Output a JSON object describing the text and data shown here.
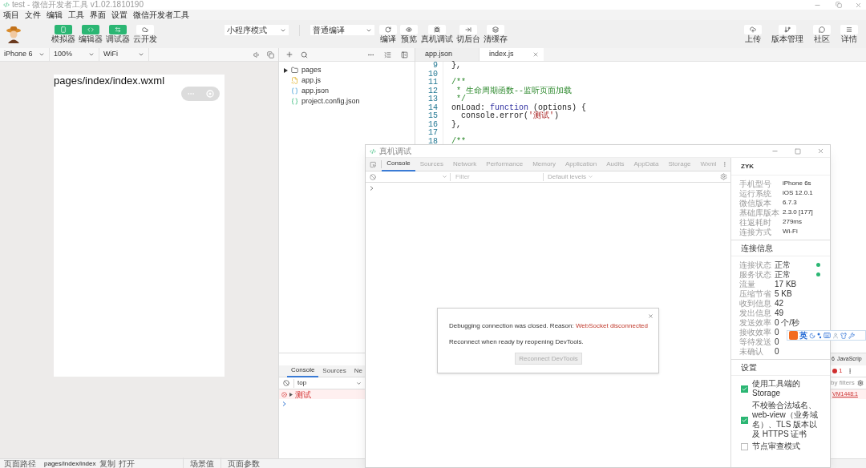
{
  "window": {
    "title": "test - 微信开发者工具 v1.02.1810190"
  },
  "menu": [
    "项目",
    "文件",
    "编辑",
    "工具",
    "界面",
    "设置",
    "微信开发者工具"
  ],
  "toolbar": {
    "toggles": [
      {
        "label": "模拟器",
        "on": true
      },
      {
        "label": "编辑器",
        "on": true
      },
      {
        "label": "调试器",
        "on": true
      },
      {
        "label": "云开发",
        "on": false
      }
    ],
    "mode_select": "小程序模式",
    "compile_select": "普通编译",
    "actions": [
      "编译",
      "预览",
      "真机调试",
      "切后台",
      "清缓存"
    ],
    "right_actions": [
      "上传",
      "版本管理",
      "社区",
      "详情"
    ]
  },
  "simulator": {
    "device": "iPhone 6",
    "zoom": "100%",
    "network": "WiFi",
    "page_text": "pages/index/index.wxml"
  },
  "file_tree": [
    {
      "name": "pages",
      "kind": "folder",
      "expanded": false
    },
    {
      "name": "app.js",
      "kind": "js"
    },
    {
      "name": "app.json",
      "kind": "json"
    },
    {
      "name": "project.config.json",
      "kind": "config"
    }
  ],
  "editor": {
    "tabs": [
      {
        "label": "app.json",
        "selected": false
      },
      {
        "label": "index.js",
        "selected": true
      }
    ],
    "lines": [
      {
        "number": "9",
        "tokens": [
          {
            "text": "},",
            "kind": "plain"
          }
        ]
      },
      {
        "number": "10"
      },
      {
        "number": "11",
        "tokens": [
          {
            "text": "/**",
            "kind": "comment"
          }
        ]
      },
      {
        "number": "12",
        "tokens": [
          {
            "text": " * 生命周期函数--监听页面加载",
            "kind": "comment"
          }
        ]
      },
      {
        "number": "13",
        "tokens": [
          {
            "text": " */",
            "kind": "comment"
          }
        ]
      },
      {
        "number": "14",
        "tokens": [
          {
            "text": "onLoad: ",
            "kind": "plain"
          },
          {
            "text": "function",
            "kind": "keyword"
          },
          {
            "text": " (options) {",
            "kind": "plain"
          }
        ]
      },
      {
        "number": "15",
        "tokens": [
          {
            "text": "  console.error(",
            "kind": "plain"
          },
          {
            "text": "'测试'",
            "kind": "string"
          },
          {
            "text": ")",
            "kind": "plain"
          }
        ]
      },
      {
        "number": "16",
        "tokens": [
          {
            "text": "},",
            "kind": "plain"
          }
        ]
      },
      {
        "number": "17"
      },
      {
        "number": "18",
        "tokens": [
          {
            "text": "/**",
            "kind": "comment"
          }
        ]
      }
    ]
  },
  "debugger": {
    "tabs": [
      {
        "label": "Console",
        "selected": true
      },
      {
        "label": "Sources",
        "selected": false
      },
      {
        "label": "Ne",
        "selected": false
      }
    ],
    "context": "top",
    "messages": [
      {
        "kind": "error",
        "text": "测试"
      }
    ],
    "right_tab_count": "6",
    "right_tab": "JavaScrip",
    "error_count": "1",
    "filter_text": "by filters",
    "source_link": "VM1448:1"
  },
  "status_bar": {
    "label": "页面路径",
    "path": "pages/index/index",
    "links": [
      "复制",
      "打开"
    ],
    "items": [
      "场景值",
      "页面参数"
    ]
  },
  "remote_debug": {
    "title": "真机调试",
    "tabs": [
      {
        "label": "Console",
        "selected": true
      },
      {
        "label": "Sources",
        "selected": false
      },
      {
        "label": "Network",
        "selected": false
      },
      {
        "label": "Performance",
        "selected": false
      },
      {
        "label": "Memory",
        "selected": false
      },
      {
        "label": "Application",
        "selected": false
      },
      {
        "label": "Audits",
        "selected": false
      },
      {
        "label": "AppData",
        "selected": false
      },
      {
        "label": "Storage",
        "selected": false
      },
      {
        "label": "Wxml",
        "selected": false
      }
    ],
    "filter_placeholder": "Filter",
    "levels": "Default levels",
    "dialog": {
      "message": "Debugging connection was closed. Reason: ",
      "reason": "WebSocket disconnected",
      "hint": "Reconnect when ready by reopening DevTools.",
      "button": "Reconnect DevTools",
      "button_disabled": true
    },
    "device_name": "ZYK",
    "info": [
      {
        "label": "手机型号",
        "value": "iPhone 6s"
      },
      {
        "label": "运行系统",
        "value": "iOS 12.0.1"
      },
      {
        "label": "微信版本",
        "value": "6.7.3"
      },
      {
        "label": "基础库版本",
        "value": "2.3.0 [177]"
      },
      {
        "label": "往返耗时",
        "value": "279ms"
      },
      {
        "label": "连接方式",
        "value": "Wi-Fi"
      }
    ],
    "connection_title": "连接信息",
    "connection": [
      {
        "label": "连接状态",
        "value": "正常",
        "color": "#2bb673"
      },
      {
        "label": "服务状态",
        "value": "正常",
        "color": "#2bb673"
      },
      {
        "label": "流量",
        "value": "17 KB"
      },
      {
        "label": "压缩节省",
        "value": "5 KB"
      },
      {
        "label": "收到信息",
        "value": "42"
      },
      {
        "label": "发出信息",
        "value": "49"
      },
      {
        "label": "发送效率",
        "value": "0 个/秒"
      },
      {
        "label": "接收效率",
        "value": "0"
      },
      {
        "label": "等待发送",
        "value": "0"
      },
      {
        "label": "未确认",
        "value": "0"
      }
    ],
    "settings_title": "设置",
    "settings": [
      {
        "label": "使用工具端的 Storage",
        "checked": true
      },
      {
        "label": "不校验合法域名、web-view（业务域名）、TLS 版本以及 HTTPS 证书",
        "checked": true
      },
      {
        "label": "节点审查模式",
        "checked": false
      }
    ]
  },
  "ime_bar": {
    "label": "英"
  }
}
